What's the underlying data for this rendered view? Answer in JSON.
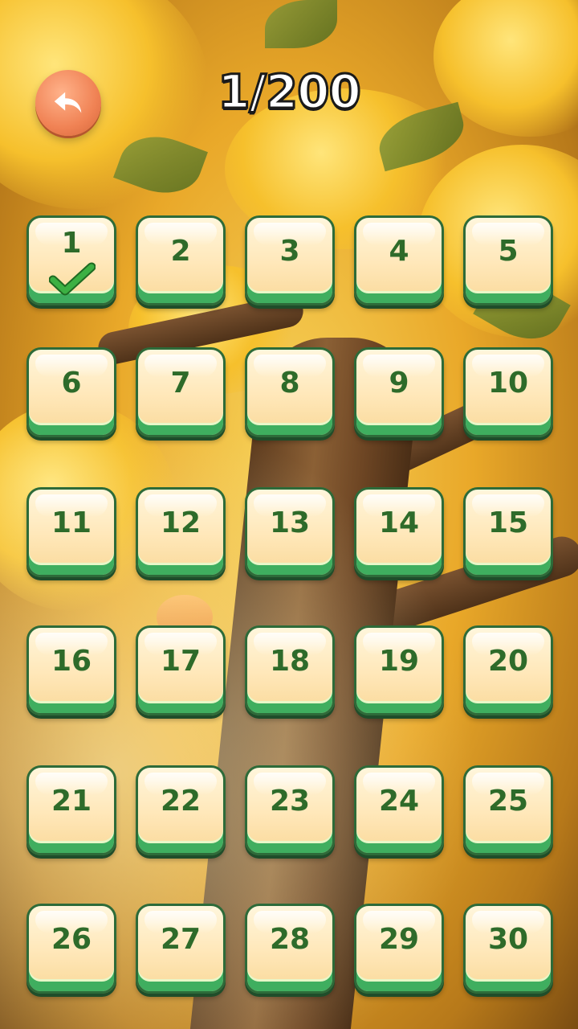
{
  "header": {
    "progress_text": "1/200",
    "back_icon": "back-arrow-icon"
  },
  "levels": [
    {
      "label": "1",
      "completed": true
    },
    {
      "label": "2",
      "completed": false
    },
    {
      "label": "3",
      "completed": false
    },
    {
      "label": "4",
      "completed": false
    },
    {
      "label": "5",
      "completed": false
    },
    {
      "label": "6",
      "completed": false
    },
    {
      "label": "7",
      "completed": false
    },
    {
      "label": "8",
      "completed": false
    },
    {
      "label": "9",
      "completed": false
    },
    {
      "label": "10",
      "completed": false
    },
    {
      "label": "11",
      "completed": false
    },
    {
      "label": "12",
      "completed": false
    },
    {
      "label": "13",
      "completed": false
    },
    {
      "label": "14",
      "completed": false
    },
    {
      "label": "15",
      "completed": false
    },
    {
      "label": "16",
      "completed": false
    },
    {
      "label": "17",
      "completed": false
    },
    {
      "label": "18",
      "completed": false
    },
    {
      "label": "19",
      "completed": false
    },
    {
      "label": "20",
      "completed": false
    },
    {
      "label": "21",
      "completed": false
    },
    {
      "label": "22",
      "completed": false
    },
    {
      "label": "23",
      "completed": false
    },
    {
      "label": "24",
      "completed": false
    },
    {
      "label": "25",
      "completed": false
    },
    {
      "label": "26",
      "completed": false
    },
    {
      "label": "27",
      "completed": false
    },
    {
      "label": "28",
      "completed": false
    },
    {
      "label": "29",
      "completed": false
    },
    {
      "label": "30",
      "completed": false
    }
  ],
  "colors": {
    "tile_number": "#2e6b2a",
    "tile_border": "#2d6b39",
    "back_button": "#f08254",
    "check": "#3cb043"
  }
}
